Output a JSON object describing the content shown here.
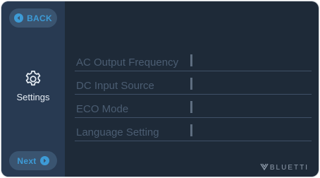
{
  "nav": {
    "back_label": "BACK",
    "next_label": "Next"
  },
  "sidebar": {
    "active_label": "Settings",
    "icon": "gear-icon"
  },
  "menu": {
    "items": [
      {
        "label": "AC Output Frequency"
      },
      {
        "label": "DC Input Source"
      },
      {
        "label": "ECO Mode"
      },
      {
        "label": "Language Setting"
      }
    ]
  },
  "brand": {
    "name": "BLUETTI"
  },
  "colors": {
    "background": "#1e2a38",
    "sidebar": "#283a52",
    "accent": "#3d9bd6",
    "menu_text": "#4b5d72"
  }
}
